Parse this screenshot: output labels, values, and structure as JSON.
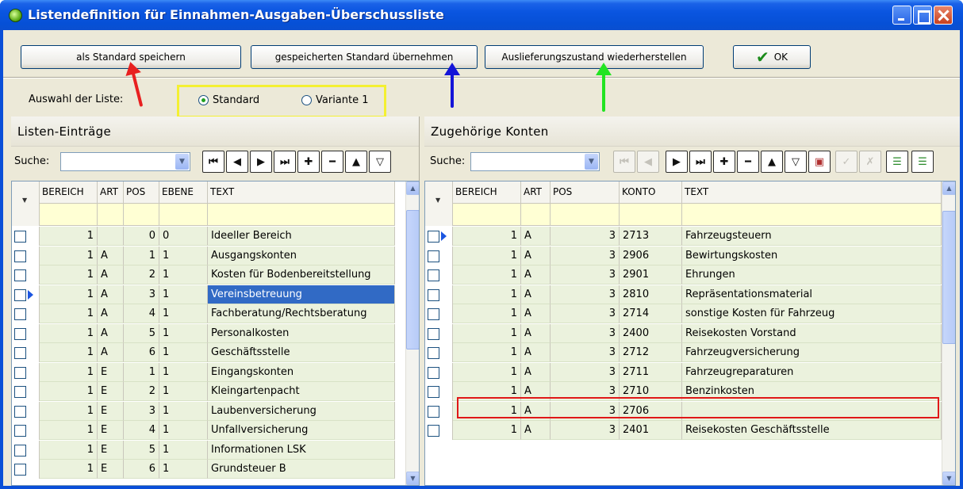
{
  "window": {
    "title": "Listendefinition für Einnahmen-Ausgaben-Überschussliste"
  },
  "toolbar": {
    "save_default": "als Standard speichern",
    "apply_default": "gespeicherten Standard übernehmen",
    "restore": "Auslieferungszustand wiederherstellen",
    "ok": "OK"
  },
  "selection": {
    "label": "Auswahl der Liste:",
    "options": [
      {
        "label": "Standard",
        "selected": true
      },
      {
        "label": "Variante 1",
        "selected": false
      }
    ]
  },
  "left_panel": {
    "title": "Listen-Einträge",
    "search_label": "Suche:",
    "columns": [
      "BEREICH",
      "ART",
      "POS",
      "EBENE",
      "TEXT"
    ],
    "rows": [
      [
        "1",
        "",
        "0",
        "0",
        "Ideeller Bereich"
      ],
      [
        "1",
        "A",
        "1",
        "1",
        "Ausgangskonten"
      ],
      [
        "1",
        "A",
        "2",
        "1",
        "Kosten für Bodenbereitstellung"
      ],
      [
        "1",
        "A",
        "3",
        "1",
        "Vereinsbetreuung"
      ],
      [
        "1",
        "A",
        "4",
        "1",
        "Fachberatung/Rechtsberatung"
      ],
      [
        "1",
        "A",
        "5",
        "1",
        "Personalkosten"
      ],
      [
        "1",
        "A",
        "6",
        "1",
        "Geschäftsstelle"
      ],
      [
        "1",
        "E",
        "1",
        "1",
        "Eingangskonten"
      ],
      [
        "1",
        "E",
        "2",
        "1",
        "Kleingartenpacht"
      ],
      [
        "1",
        "E",
        "3",
        "1",
        "Laubenversicherung"
      ],
      [
        "1",
        "E",
        "4",
        "1",
        "Unfallversicherung"
      ],
      [
        "1",
        "E",
        "5",
        "1",
        "Informationen LSK"
      ],
      [
        "1",
        "E",
        "6",
        "1",
        "Grundsteuer B"
      ]
    ]
  },
  "right_panel": {
    "title": "Zugehörige Konten",
    "search_label": "Suche:",
    "columns": [
      "BEREICH",
      "ART",
      "POS",
      "KONTO",
      "TEXT"
    ],
    "rows": [
      [
        "1",
        "A",
        "3",
        "2713",
        "Fahrzeugsteuern"
      ],
      [
        "1",
        "A",
        "3",
        "2906",
        "Bewirtungskosten"
      ],
      [
        "1",
        "A",
        "3",
        "2901",
        "Ehrungen"
      ],
      [
        "1",
        "A",
        "3",
        "2810",
        "Repräsentationsmaterial"
      ],
      [
        "1",
        "A",
        "3",
        "2714",
        "sonstige Kosten für Fahrzeug"
      ],
      [
        "1",
        "A",
        "3",
        "2400",
        "Reisekosten Vorstand"
      ],
      [
        "1",
        "A",
        "3",
        "2712",
        "Fahrzeugversicherung"
      ],
      [
        "1",
        "A",
        "3",
        "2711",
        "Fahrzeugreparaturen"
      ],
      [
        "1",
        "A",
        "3",
        "2710",
        "Benzinkosten"
      ],
      [
        "1",
        "A",
        "3",
        "2706",
        ""
      ],
      [
        "1",
        "A",
        "3",
        "2401",
        "Reisekosten Geschäftsstelle"
      ]
    ]
  },
  "colors": {
    "titlebar": "#0a55e0",
    "row_fill": "#ebf2dd",
    "selected_row": "#316ac5",
    "filter_row": "#ffffd4",
    "annotation_red": "#e82020",
    "annotation_blue": "#1414d8",
    "annotation_green": "#22e422",
    "annotation_yellow": "#f4f032"
  }
}
